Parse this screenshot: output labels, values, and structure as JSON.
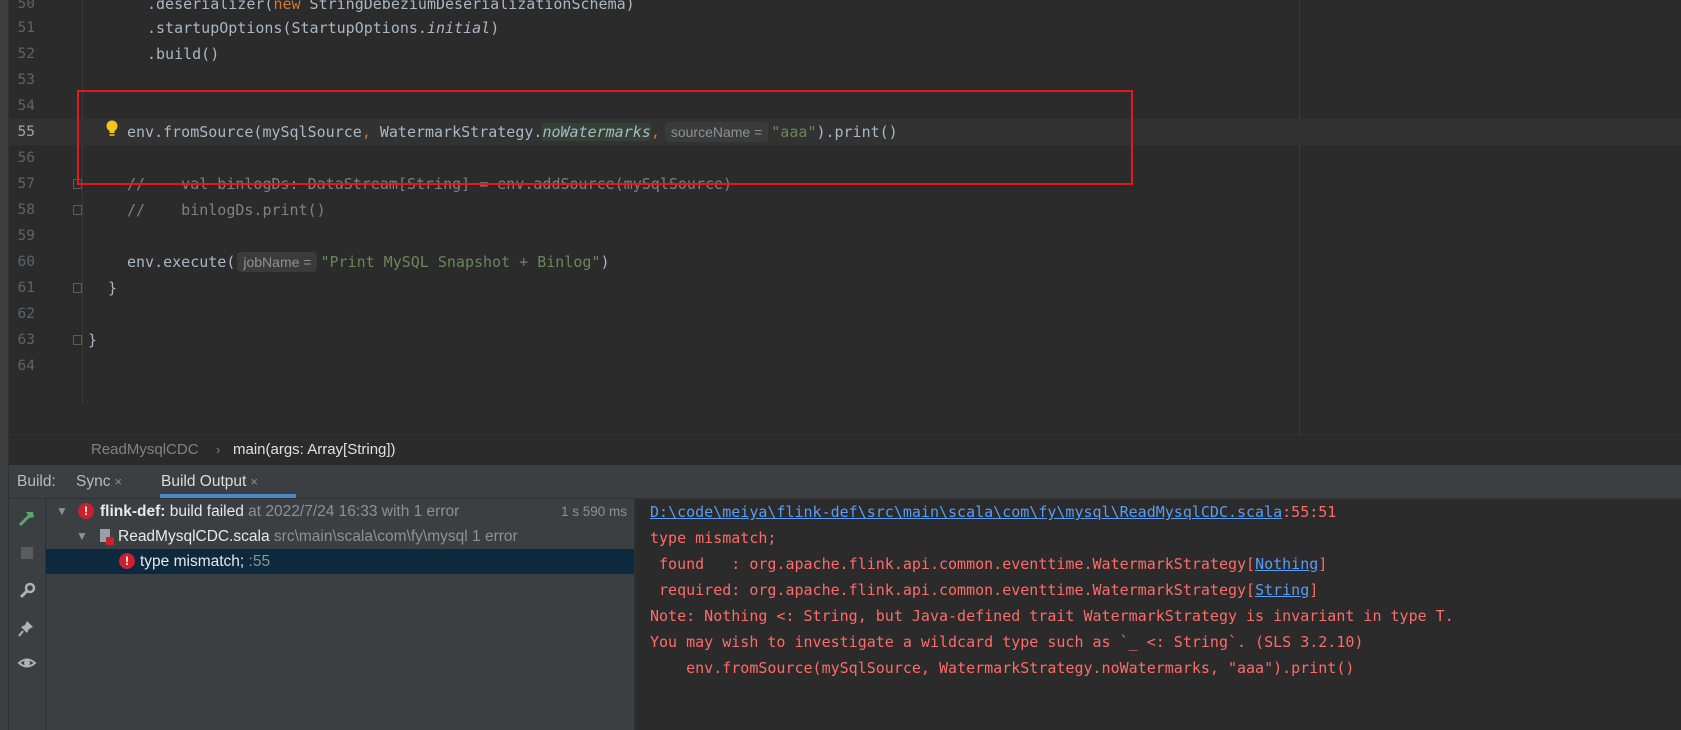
{
  "editor": {
    "lines": [
      {
        "num": "50",
        "parts": [
          ".deserializer(",
          "new",
          " StringDebeziumDeserializationSchema)"
        ]
      },
      {
        "num": "51",
        "parts": [
          ".startupOptions(StartupOptions.",
          "initial",
          ")"
        ]
      },
      {
        "num": "52",
        "parts": [
          ".build()"
        ]
      },
      {
        "num": "53",
        "parts": []
      },
      {
        "num": "54",
        "parts": []
      },
      {
        "num": "55",
        "parts": [
          "env.fromSource(mySqlSource",
          ", ",
          "WatermarkStrategy.",
          "noWatermarks",
          ",",
          "sourceName =",
          "\"aaa\"",
          ").print()"
        ]
      },
      {
        "num": "56",
        "parts": []
      },
      {
        "num": "57",
        "parts": [
          "//    val binlogDs: DataStream[String] = env.addSource(mySqlSource)"
        ]
      },
      {
        "num": "58",
        "parts": [
          "//    binlogDs.print()"
        ]
      },
      {
        "num": "59",
        "parts": []
      },
      {
        "num": "60",
        "parts": [
          "env.execute(",
          "jobName =",
          "\"Print MySQL Snapshot + Binlog\"",
          ")"
        ]
      },
      {
        "num": "61",
        "parts": [
          "}"
        ]
      },
      {
        "num": "62",
        "parts": []
      },
      {
        "num": "63",
        "parts": [
          "}"
        ]
      },
      {
        "num": "64",
        "parts": []
      }
    ],
    "icons": {
      "intention": "lightbulb-icon",
      "fold": "fold-marker-icon"
    }
  },
  "breadcrumb": {
    "file": "ReadMysqlCDC",
    "separator": "›",
    "method": "main(args: Array[String])"
  },
  "build_panel": {
    "label": "Build:",
    "tabs": [
      {
        "label": "Sync",
        "close": "×"
      },
      {
        "label": "Build Output",
        "close": "×"
      }
    ],
    "toolbar_icons": [
      "hammer-icon",
      "stop-icon",
      "wrench-icon",
      "pin-icon",
      "eye-icon"
    ],
    "tree": {
      "root": {
        "name": "flink-def:",
        "status": "build failed",
        "detail": "at 2022/7/24 16:33 with 1 error",
        "time": "1 s 590 ms"
      },
      "file": {
        "name": "ReadMysqlCDC.scala",
        "path": "src\\main\\scala\\com\\fy\\mysql",
        "errors": "1 error"
      },
      "error": {
        "message": "type mismatch;",
        "line": ":55"
      }
    },
    "console": {
      "location_link": "D:\\code\\meiya\\flink-def\\src\\main\\scala\\com\\fy\\mysql\\ReadMysqlCDC.scala",
      "location_pos": ":55:51",
      "line1": "type mismatch;",
      "found_prefix": " found   : org.apache.flink.api.common.eventtime.WatermarkStrategy[",
      "found_type": "Nothing",
      "required_prefix": " required: org.apache.flink.api.common.eventtime.WatermarkStrategy[",
      "required_type": "String",
      "close_bracket": "]",
      "note": "Note: Nothing <: String, but Java-defined trait WatermarkStrategy is invariant in type T.",
      "hint": "You may wish to investigate a wildcard type such as `_ <: String`. (SLS 3.2.10)",
      "source": "    env.fromSource(mySqlSource, WatermarkStrategy.noWatermarks, \"aaa\").print()"
    }
  },
  "colors": {
    "error_red": "#ff6b68",
    "link_blue": "#589df6",
    "highlight_box": "#e0191c",
    "selection": "#0d293e"
  }
}
